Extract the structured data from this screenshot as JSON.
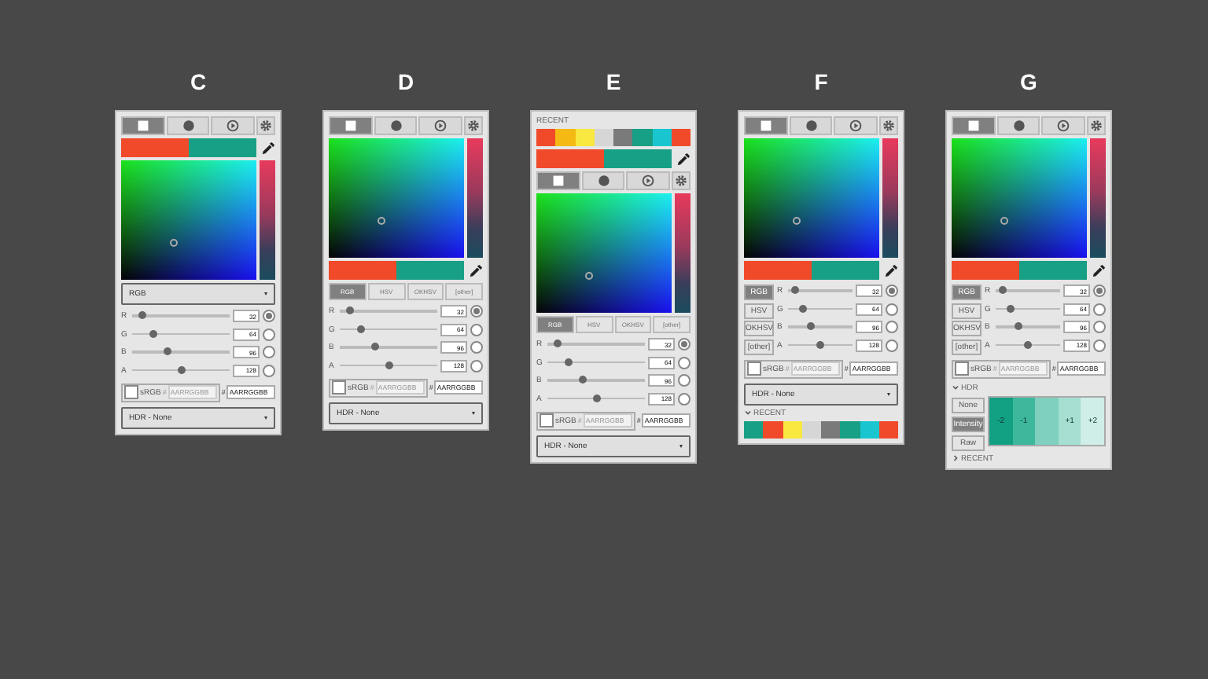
{
  "panels": [
    {
      "label": "C",
      "sections": [
        {
          "kind": "icon_tabs",
          "tabs": [
            {
              "selected": true
            },
            {
              "selected": false
            },
            {
              "selected": false
            }
          ]
        },
        {
          "kind": "swatches",
          "colors": [
            {
              "color": "#f04a2b"
            },
            {
              "color": "#17a085"
            }
          ]
        },
        {
          "kind": "picker"
        },
        {
          "kind": "mode_dropdown",
          "value": "RGB"
        },
        {
          "kind": "sliders",
          "channels": [
            {
              "name": "R",
              "level": 0.1,
              "value": "32",
              "selected": true
            },
            {
              "name": "G",
              "level": 0.22,
              "value": "64",
              "selected": false
            },
            {
              "name": "B",
              "level": 0.36,
              "value": "96",
              "selected": false
            },
            {
              "name": "A",
              "level": 0.5,
              "value": "128",
              "selected": false
            }
          ]
        },
        {
          "kind": "hex_row",
          "srgb_checked": false,
          "srgb_label": "sRGB",
          "fields": [
            {
              "prefix": "#",
              "placeholder": "AARRGGBB",
              "disabled": true
            },
            {
              "prefix": "#",
              "value": "AARRGGBB",
              "disabled": false
            }
          ]
        },
        {
          "kind": "hdr_dropdown",
          "value": "HDR - None"
        }
      ]
    },
    {
      "label": "D",
      "sections": [
        {
          "kind": "icon_tabs",
          "tabs": [
            {
              "selected": true
            },
            {
              "selected": false
            },
            {
              "selected": false
            }
          ]
        },
        {
          "kind": "picker"
        },
        {
          "kind": "swatches",
          "colors": [
            {
              "color": "#f04a2b"
            },
            {
              "color": "#17a085"
            }
          ]
        },
        {
          "kind": "mode_tabs",
          "modes": [
            {
              "label": "RGB",
              "selected": true
            },
            {
              "label": "HSV",
              "selected": false
            },
            {
              "label": "OKHSV",
              "selected": false
            },
            {
              "label": "[other]",
              "selected": false
            }
          ]
        },
        {
          "kind": "sliders",
          "channels": [
            {
              "name": "R",
              "level": 0.1,
              "value": "32",
              "selected": true
            },
            {
              "name": "G",
              "level": 0.22,
              "value": "64",
              "selected": false
            },
            {
              "name": "B",
              "level": 0.36,
              "value": "96",
              "selected": false
            },
            {
              "name": "A",
              "level": 0.5,
              "value": "128",
              "selected": false
            }
          ]
        },
        {
          "kind": "hex_row",
          "srgb_checked": false,
          "srgb_label": "sRGB",
          "fields": [
            {
              "prefix": "#",
              "placeholder": "AARRGGBB",
              "disabled": true
            },
            {
              "prefix": "#",
              "value": "AARRGGBB",
              "disabled": false
            }
          ]
        },
        {
          "kind": "hdr_dropdown",
          "value": "HDR - None"
        }
      ]
    },
    {
      "label": "E",
      "sections": [
        {
          "kind": "recent",
          "title": "RECENT",
          "colors": [
            {
              "color": "#f04a2b"
            },
            {
              "color": "#f5b914"
            },
            {
              "color": "#f8e83f"
            },
            {
              "color": "#d6d6d6"
            },
            {
              "color": "#7a7a7a"
            },
            {
              "color": "#17a085"
            },
            {
              "color": "#19c6d0"
            },
            {
              "color": "#f04a2b"
            }
          ]
        },
        {
          "kind": "swatches",
          "colors": [
            {
              "color": "#f04a2b"
            },
            {
              "color": "#17a085"
            }
          ]
        },
        {
          "kind": "icon_tabs",
          "tabs": [
            {
              "selected": true
            },
            {
              "selected": false
            },
            {
              "selected": false
            }
          ]
        },
        {
          "kind": "picker"
        },
        {
          "kind": "mode_tabs",
          "modes": [
            {
              "label": "RGB",
              "selected": true
            },
            {
              "label": "HSV",
              "selected": false
            },
            {
              "label": "OKHSV",
              "selected": false
            },
            {
              "label": "[other]",
              "selected": false
            }
          ]
        },
        {
          "kind": "sliders",
          "channels": [
            {
              "name": "R",
              "level": 0.1,
              "value": "32",
              "selected": true
            },
            {
              "name": "G",
              "level": 0.22,
              "value": "64",
              "selected": false
            },
            {
              "name": "B",
              "level": 0.36,
              "value": "96",
              "selected": false
            },
            {
              "name": "A",
              "level": 0.5,
              "value": "128",
              "selected": false
            }
          ]
        },
        {
          "kind": "hex_row",
          "srgb_checked": false,
          "srgb_label": "sRGB",
          "fields": [
            {
              "prefix": "#",
              "placeholder": "AARRGGBB",
              "disabled": true
            },
            {
              "prefix": "#",
              "value": "AARRGGBB",
              "disabled": false
            }
          ]
        },
        {
          "kind": "hdr_dropdown",
          "value": "HDR - None"
        }
      ]
    },
    {
      "label": "F",
      "sections": [
        {
          "kind": "icon_tabs",
          "tabs": [
            {
              "selected": true
            },
            {
              "selected": false
            },
            {
              "selected": false
            }
          ]
        },
        {
          "kind": "picker"
        },
        {
          "kind": "swatches",
          "colors": [
            {
              "color": "#f04a2b"
            },
            {
              "color": "#17a085"
            }
          ]
        },
        {
          "kind": "sliders",
          "modes": [
            {
              "label": "RGB",
              "selected": true
            },
            {
              "label": "HSV",
              "selected": false
            },
            {
              "label": "OKHSV",
              "selected": false
            },
            {
              "label": "[other]",
              "selected": false
            }
          ],
          "channels": [
            {
              "name": "R",
              "level": 0.1,
              "value": "32",
              "selected": true
            },
            {
              "name": "G",
              "level": 0.22,
              "value": "64",
              "selected": false
            },
            {
              "name": "B",
              "level": 0.36,
              "value": "96",
              "selected": false
            },
            {
              "name": "A",
              "level": 0.5,
              "value": "128",
              "selected": false
            }
          ]
        },
        {
          "kind": "hex_row",
          "srgb_checked": false,
          "srgb_label": "sRGB",
          "fields": [
            {
              "prefix": "#",
              "placeholder": "AARRGGBB",
              "disabled": true
            },
            {
              "prefix": "#",
              "value": "AARRGGBB",
              "disabled": false
            }
          ]
        },
        {
          "kind": "hdr_dropdown",
          "value": "HDR - None"
        },
        {
          "kind": "recent",
          "title": "RECENT",
          "expanded": true,
          "colors": [
            {
              "color": "#17a085"
            },
            {
              "color": "#f04a2b"
            },
            {
              "color": "#f8e83f"
            },
            {
              "color": "#d6d6d6"
            },
            {
              "color": "#7a7a7a"
            },
            {
              "color": "#17a085"
            },
            {
              "color": "#19c6d0"
            },
            {
              "color": "#f04a2b"
            }
          ]
        }
      ]
    },
    {
      "label": "G",
      "sections": [
        {
          "kind": "icon_tabs",
          "tabs": [
            {
              "selected": true
            },
            {
              "selected": false
            },
            {
              "selected": false
            }
          ]
        },
        {
          "kind": "picker"
        },
        {
          "kind": "swatches",
          "colors": [
            {
              "color": "#f04a2b"
            },
            {
              "color": "#17a085"
            }
          ]
        },
        {
          "kind": "sliders",
          "modes": [
            {
              "label": "RGB",
              "selected": true
            },
            {
              "label": "HSV",
              "selected": false
            },
            {
              "label": "OKHSV",
              "selected": false
            },
            {
              "label": "[other]",
              "selected": false
            }
          ],
          "channels": [
            {
              "name": "R",
              "level": 0.1,
              "value": "32",
              "selected": true
            },
            {
              "name": "G",
              "level": 0.22,
              "value": "64",
              "selected": false
            },
            {
              "name": "B",
              "level": 0.36,
              "value": "96",
              "selected": false
            },
            {
              "name": "A",
              "level": 0.5,
              "value": "128",
              "selected": false
            }
          ]
        },
        {
          "kind": "hex_row",
          "srgb_checked": false,
          "srgb_label": "sRGB",
          "fields": [
            {
              "prefix": "#",
              "placeholder": "AARRGGBB",
              "disabled": true
            },
            {
              "prefix": "#",
              "value": "AARRGGBB",
              "disabled": false
            }
          ]
        },
        {
          "kind": "hdr_section",
          "title": "HDR",
          "expanded": true,
          "modes": [
            {
              "label": "None",
              "selected": false
            },
            {
              "label": "Intensity",
              "selected": true
            },
            {
              "label": "Raw",
              "selected": false
            }
          ],
          "steps": [
            {
              "label": "-2",
              "color": "#12a083"
            },
            {
              "label": "-1",
              "color": "#3db89c"
            },
            {
              "color": "#7fd0be"
            },
            {
              "label": "+1",
              "color": "#a6dfd2"
            },
            {
              "label": "+2",
              "color": "#cfeee7"
            }
          ]
        },
        {
          "kind": "recent",
          "title": "RECENT",
          "expanded": false
        }
      ]
    }
  ]
}
